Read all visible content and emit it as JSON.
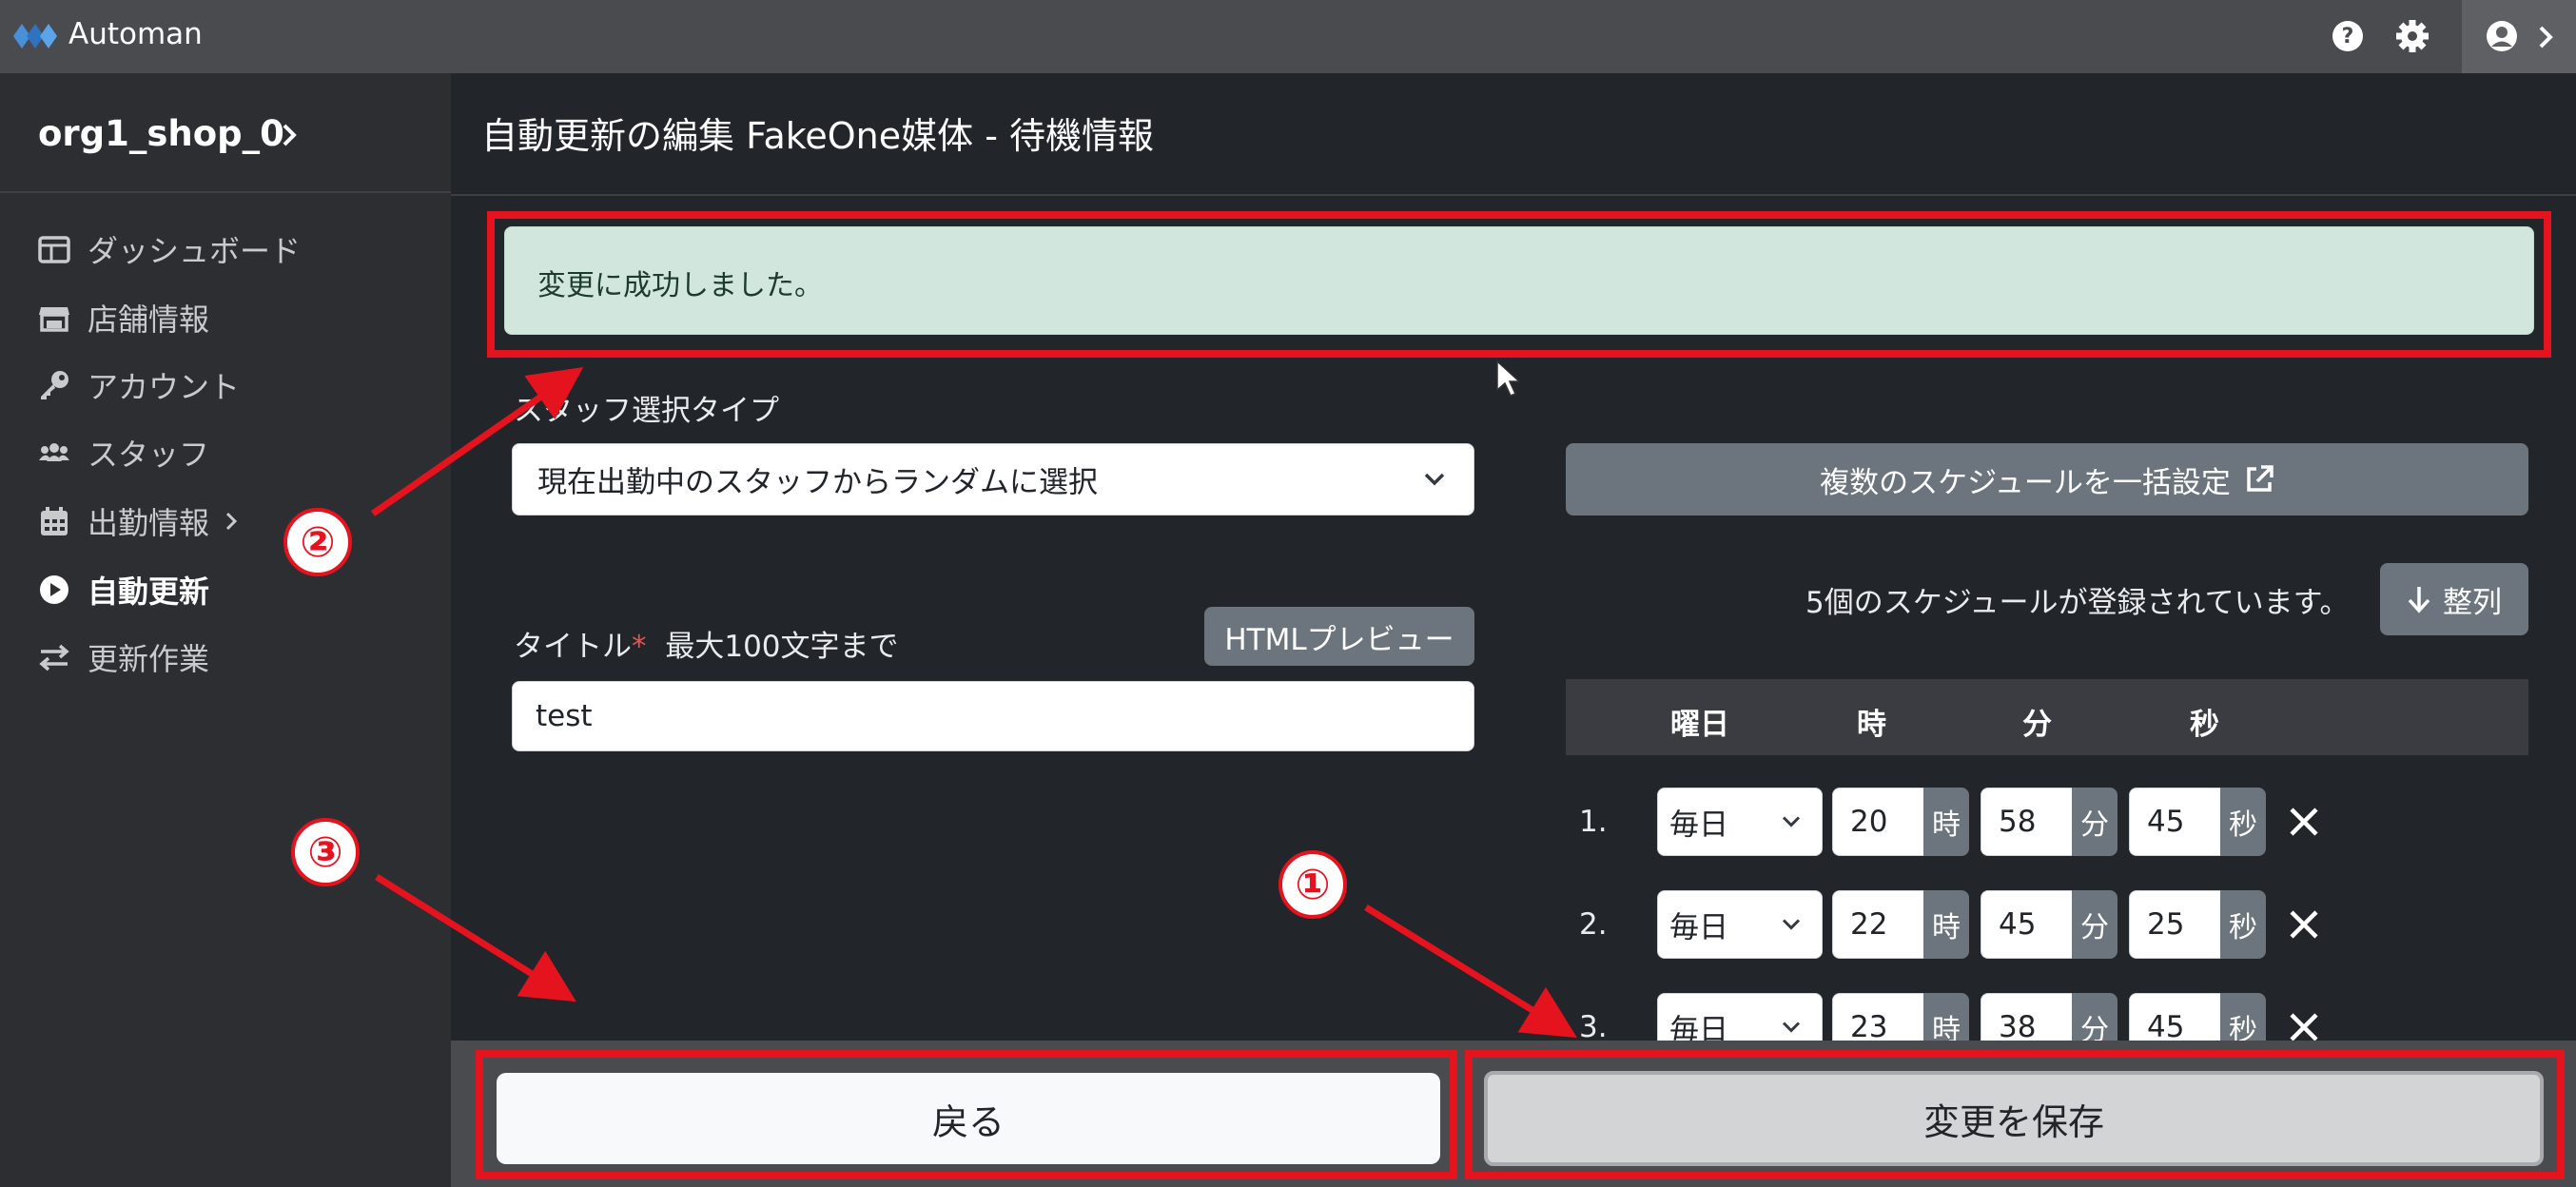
{
  "app": {
    "title": "Automan"
  },
  "sidebar": {
    "shop_name": "org1_shop_0",
    "items": [
      {
        "label": "ダッシュボード",
        "icon": "dashboard-icon"
      },
      {
        "label": "店舗情報",
        "icon": "store-icon"
      },
      {
        "label": "アカウント",
        "icon": "key-icon"
      },
      {
        "label": "スタッフ",
        "icon": "users-icon"
      },
      {
        "label": "出勤情報",
        "icon": "calendar-icon"
      },
      {
        "label": "自動更新",
        "icon": "play-circle-icon"
      },
      {
        "label": "更新作業",
        "icon": "exchange-icon"
      }
    ]
  },
  "page": {
    "title": "自動更新の編集 FakeOne媒体 - 待機情報"
  },
  "alert": {
    "message": "変更に成功しました。"
  },
  "form": {
    "staff_type_label": "スタッフ選択タイプ",
    "staff_type_value": "現在出勤中のスタッフからランダムに選択",
    "title_label": "タイトル",
    "title_required": "*",
    "title_hint": "最大100文字まで",
    "html_preview_label": "HTMLプレビュー",
    "title_value": "test"
  },
  "schedule": {
    "bulk_button": "複数のスケジュールを一括設定",
    "count_text": "5個のスケジュールが登録されています。",
    "sort_button": "整列",
    "headers": {
      "day": "曜日",
      "hour": "時",
      "minute": "分",
      "second": "秒"
    },
    "rows": [
      {
        "num": "1.",
        "day": "毎日",
        "hour": "20",
        "minute": "58",
        "second": "45"
      },
      {
        "num": "2.",
        "day": "毎日",
        "hour": "22",
        "minute": "45",
        "second": "25"
      },
      {
        "num": "3.",
        "day": "毎日",
        "hour": "23",
        "minute": "38",
        "second": "45"
      }
    ],
    "units": {
      "hour": "時",
      "minute": "分",
      "second": "秒"
    }
  },
  "footer": {
    "back_label": "戻る",
    "save_label": "変更を保存"
  },
  "annotations": {
    "badge1": "①",
    "badge2": "②",
    "badge3": "③"
  },
  "colors": {
    "highlight": "#e5131d",
    "alert_bg": "#d1e7dd",
    "topbar": "#4a4b4f",
    "sidebar": "#2c2e32",
    "content": "#222529"
  }
}
